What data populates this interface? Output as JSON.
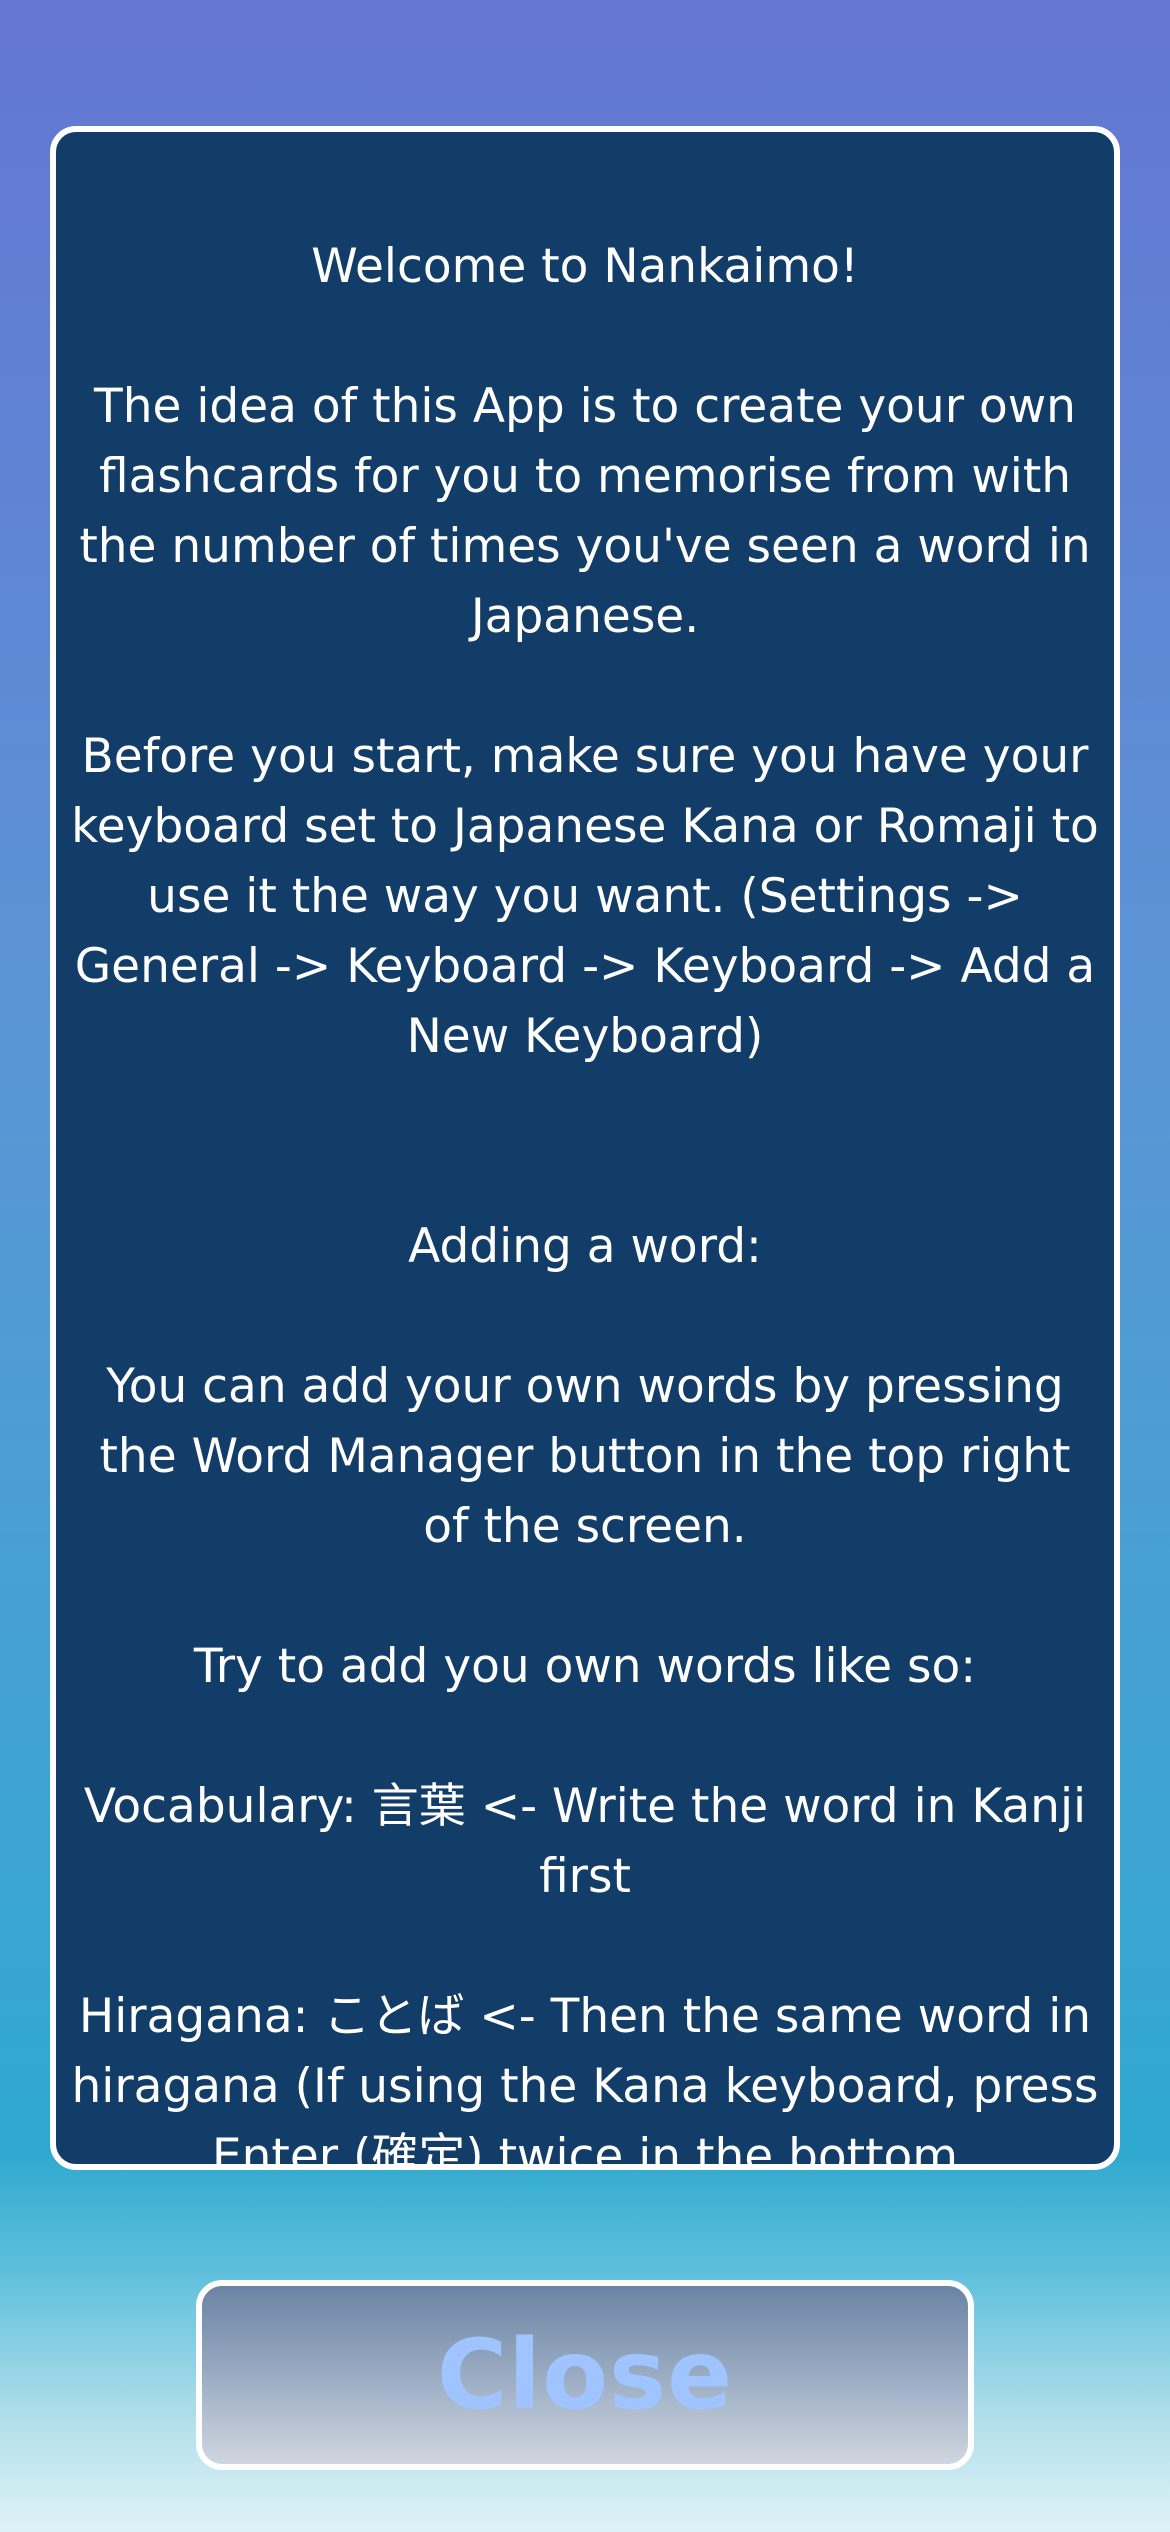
{
  "colors": {
    "card_background": "#133d69",
    "card_border": "#ffffff",
    "text": "#ffffff",
    "close_label": "#9fc4ff"
  },
  "dialog": {
    "paragraphs": [
      "Welcome to Nankaimo!",
      "The idea of this App is to create your own flashcards for you to memorise from with the number of times you've seen a word in Japanese.",
      "Before you start, make sure you have your keyboard set to Japanese Kana or Romaji to use it the way you want. (Settings -> General -> Keyboard -> Keyboard -> Add a New Keyboard)",
      "Adding a word:",
      "You can add your own words by pressing the Word Manager button in the top right of the screen.",
      "Try to add you own words like so:",
      "Vocabulary: 言葉 <- Write the word in Kanji first",
      "Hiragana: ことば <- Then the same word in hiragana (If using the Kana keyboard, press Enter (確定) twice in the bottom"
    ]
  },
  "close_button": {
    "label": "Close"
  }
}
